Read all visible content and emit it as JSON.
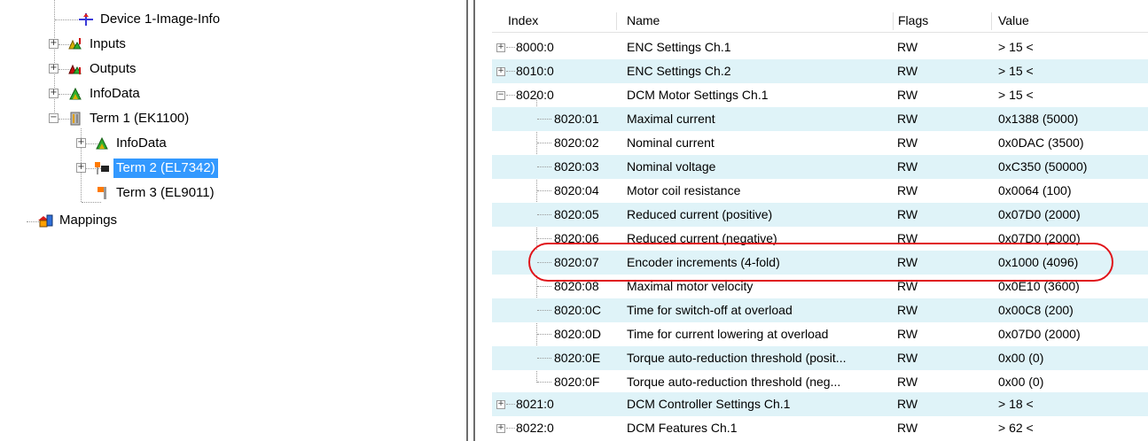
{
  "tree": {
    "items": [
      {
        "label": "Device 1-Image-Info",
        "icon": "image-info-icon"
      },
      {
        "label": "Inputs",
        "icon": "inputs-icon"
      },
      {
        "label": "Outputs",
        "icon": "outputs-icon"
      },
      {
        "label": "InfoData",
        "icon": "infodata-icon"
      },
      {
        "label": "Term 1 (EK1100)",
        "icon": "coupler-terminal-icon"
      },
      {
        "label": "InfoData",
        "icon": "infodata-icon"
      },
      {
        "label": "Term 2 (EL7342)",
        "icon": "motor-terminal-icon",
        "selected": true
      },
      {
        "label": "Term 3 (EL9011)",
        "icon": "end-terminal-icon"
      },
      {
        "label": "Mappings",
        "icon": "mappings-icon"
      }
    ]
  },
  "table": {
    "columns": [
      "Index",
      "Name",
      "Flags",
      "Value"
    ],
    "rows": [
      {
        "index": "8000:0",
        "name": "ENC Settings Ch.1",
        "flags": "RW",
        "value": "> 15 <",
        "expander": "+"
      },
      {
        "index": "8010:0",
        "name": "ENC Settings Ch.2",
        "flags": "RW",
        "value": "> 15 <",
        "expander": "+"
      },
      {
        "index": "8020:0",
        "name": "DCM Motor Settings Ch.1",
        "flags": "RW",
        "value": "> 15 <",
        "expander": "−"
      },
      {
        "index": "8020:01",
        "name": "Maximal current",
        "flags": "RW",
        "value": "0x1388 (5000)"
      },
      {
        "index": "8020:02",
        "name": "Nominal current",
        "flags": "RW",
        "value": "0x0DAC (3500)"
      },
      {
        "index": "8020:03",
        "name": "Nominal voltage",
        "flags": "RW",
        "value": "0xC350 (50000)"
      },
      {
        "index": "8020:04",
        "name": "Motor coil resistance",
        "flags": "RW",
        "value": "0x0064 (100)"
      },
      {
        "index": "8020:05",
        "name": "Reduced current (positive)",
        "flags": "RW",
        "value": "0x07D0 (2000)"
      },
      {
        "index": "8020:06",
        "name": "Reduced current (negative)",
        "flags": "RW",
        "value": "0x07D0 (2000)"
      },
      {
        "index": "8020:07",
        "name": "Encoder increments (4-fold)",
        "flags": "RW",
        "value": "0x1000 (4096)",
        "highlighted": true
      },
      {
        "index": "8020:08",
        "name": "Maximal motor velocity",
        "flags": "RW",
        "value": "0x0E10 (3600)"
      },
      {
        "index": "8020:0C",
        "name": "Time for switch-off at overload",
        "flags": "RW",
        "value": "0x00C8 (200)"
      },
      {
        "index": "8020:0D",
        "name": "Time for current lowering at overload",
        "flags": "RW",
        "value": "0x07D0 (2000)"
      },
      {
        "index": "8020:0E",
        "name": "Torque auto-reduction threshold (posit...",
        "flags": "RW",
        "value": "0x00 (0)"
      },
      {
        "index": "8020:0F",
        "name": "Torque auto-reduction threshold (neg...",
        "flags": "RW",
        "value": "0x00 (0)"
      },
      {
        "index": "8021:0",
        "name": "DCM Controller Settings Ch.1",
        "flags": "RW",
        "value": "> 18 <",
        "expander": "+"
      },
      {
        "index": "8022:0",
        "name": "DCM Features Ch.1",
        "flags": "RW",
        "value": "> 62 <",
        "expander": "+"
      }
    ]
  },
  "colors": {
    "row_alt": "#dff3f8",
    "selection": "#3399ff",
    "highlight_outline": "#e0141a"
  }
}
